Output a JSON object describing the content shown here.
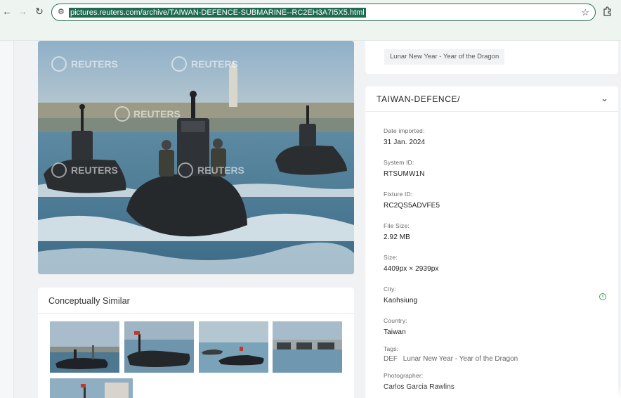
{
  "browser": {
    "url": "pictures.reuters.com/archive/TAIWAN-DEFENCE-SUBMARINE--RC2EH3A7I5X5.html"
  },
  "watermark": "REUTERS",
  "similar": {
    "title": "Conceptually Similar"
  },
  "tag_chip": "Lunar New Year - Year of the Dragon",
  "metadata": {
    "header": "TAIWAN-DEFENCE/",
    "fields": [
      {
        "label": "Date imported:",
        "value": "31 Jan. 2024"
      },
      {
        "label": "System ID:",
        "value": "RTSUMW1N"
      },
      {
        "label": "Fixture ID:",
        "value": "RC2QS5ADVFE5"
      },
      {
        "label": "File Size:",
        "value": "2.92 MB"
      },
      {
        "label": "Size:",
        "value": "4409px × 2939px"
      },
      {
        "label": "City:",
        "value": "Kaohsiung"
      },
      {
        "label": "Country:",
        "value": "Taiwan"
      }
    ],
    "tags": {
      "label": "Tags:",
      "items": [
        "DEF",
        "Lunar New Year - Year of the Dragon"
      ]
    },
    "photographer": {
      "label": "Photographer:",
      "value": "Carlos Garcia Rawlins"
    }
  },
  "colors": {
    "accent": "#1f6b4f",
    "sea": "#4f7f9a",
    "boat": "#2b2e31",
    "info": "#3e9a5b"
  },
  "icons": {
    "back": "arrow-left-icon",
    "forward": "arrow-right-icon",
    "reload": "reload-icon",
    "site_info": "tune-icon",
    "bookmark": "star-icon",
    "extensions": "puzzle-icon",
    "expand": "chevron-down-icon",
    "info": "info-icon"
  }
}
